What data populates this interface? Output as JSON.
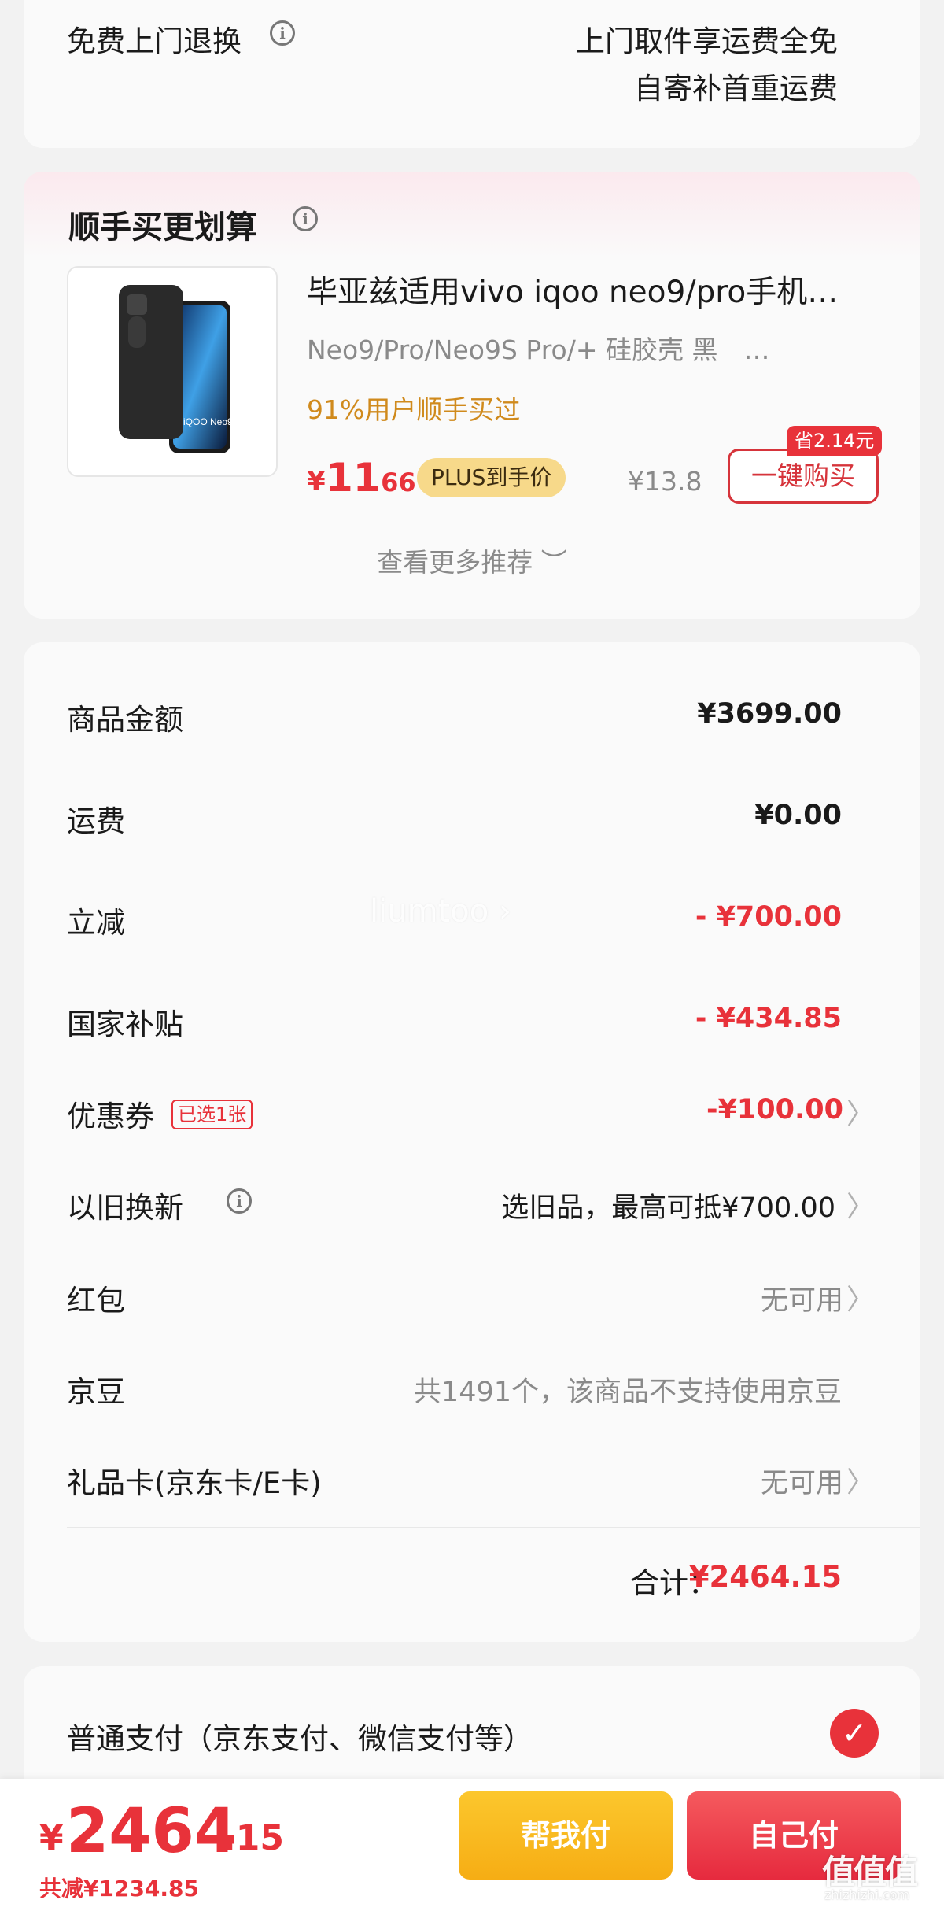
{
  "return_service": {
    "label": "免费上门退换",
    "line1": "上门取件享运费全免",
    "line2": "自寄补首重运费"
  },
  "recommend": {
    "title": "顺手买更划算",
    "product_name": "毕亚兹适用vivo iqoo neo9/pro手机…",
    "product_spec": "Neo9/Pro/Neo9S Pro/+ 硅胶壳 黑　…",
    "bought_text": "91%用户顺手买过",
    "price_yen": "¥",
    "price_int": "11",
    "price_dec": ".66",
    "plus_badge": "PLUS到手价",
    "orig_price": "¥13.8",
    "save_tag": "省2.14元",
    "buy_label": "一键购买",
    "more_label": "查看更多推荐 ︶",
    "thumb_text": "iQOO Neo9"
  },
  "price_detail": {
    "rows": [
      {
        "label": "商品金额",
        "value": "¥3699.00"
      },
      {
        "label": "运费",
        "value": "¥0.00"
      },
      {
        "label": "立减",
        "value": "- ¥700.00"
      },
      {
        "label": "国家补贴",
        "value": "- ¥434.85"
      },
      {
        "label": "优惠券",
        "value": "-¥100.00",
        "badge": "已选1张"
      },
      {
        "label": "以旧换新",
        "value": "选旧品，最高可抵¥700.00"
      },
      {
        "label": "红包",
        "value": "无可用"
      },
      {
        "label": "京豆",
        "value": "共1491个，该商品不支持使用京豆"
      },
      {
        "label": "礼品卡(京东卡/E卡)",
        "value": "无可用"
      }
    ],
    "total_label": "合计：",
    "total_value": "¥2464.15",
    "chevron": "〉"
  },
  "payment": {
    "label": "普通支付（京东支付、微信支付等）",
    "check": "✓"
  },
  "bottom": {
    "yen": "¥",
    "int": "2464",
    "dec": ".15",
    "saved": "共减¥1234.85",
    "help_pay": "帮我付",
    "self_pay": "自己付"
  },
  "watermark": "liumtoo ›",
  "site_mark": "值值值",
  "site_mark_url": "zhizhizhi.com",
  "colors": {
    "accent_red": "#e8323a",
    "gold": "#d08a1c",
    "yellow_btn": "#f6ad14"
  }
}
